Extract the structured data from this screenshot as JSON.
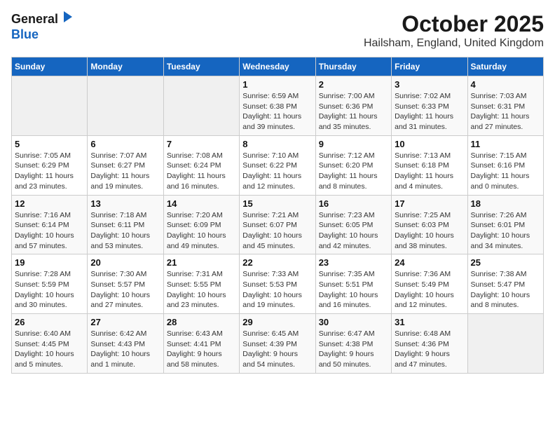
{
  "logo": {
    "general": "General",
    "blue": "Blue"
  },
  "title": "October 2025",
  "location": "Hailsham, England, United Kingdom",
  "weekdays": [
    "Sunday",
    "Monday",
    "Tuesday",
    "Wednesday",
    "Thursday",
    "Friday",
    "Saturday"
  ],
  "weeks": [
    [
      {
        "day": "",
        "info": ""
      },
      {
        "day": "",
        "info": ""
      },
      {
        "day": "",
        "info": ""
      },
      {
        "day": "1",
        "info": "Sunrise: 6:59 AM\nSunset: 6:38 PM\nDaylight: 11 hours\nand 39 minutes."
      },
      {
        "day": "2",
        "info": "Sunrise: 7:00 AM\nSunset: 6:36 PM\nDaylight: 11 hours\nand 35 minutes."
      },
      {
        "day": "3",
        "info": "Sunrise: 7:02 AM\nSunset: 6:33 PM\nDaylight: 11 hours\nand 31 minutes."
      },
      {
        "day": "4",
        "info": "Sunrise: 7:03 AM\nSunset: 6:31 PM\nDaylight: 11 hours\nand 27 minutes."
      }
    ],
    [
      {
        "day": "5",
        "info": "Sunrise: 7:05 AM\nSunset: 6:29 PM\nDaylight: 11 hours\nand 23 minutes."
      },
      {
        "day": "6",
        "info": "Sunrise: 7:07 AM\nSunset: 6:27 PM\nDaylight: 11 hours\nand 19 minutes."
      },
      {
        "day": "7",
        "info": "Sunrise: 7:08 AM\nSunset: 6:24 PM\nDaylight: 11 hours\nand 16 minutes."
      },
      {
        "day": "8",
        "info": "Sunrise: 7:10 AM\nSunset: 6:22 PM\nDaylight: 11 hours\nand 12 minutes."
      },
      {
        "day": "9",
        "info": "Sunrise: 7:12 AM\nSunset: 6:20 PM\nDaylight: 11 hours\nand 8 minutes."
      },
      {
        "day": "10",
        "info": "Sunrise: 7:13 AM\nSunset: 6:18 PM\nDaylight: 11 hours\nand 4 minutes."
      },
      {
        "day": "11",
        "info": "Sunrise: 7:15 AM\nSunset: 6:16 PM\nDaylight: 11 hours\nand 0 minutes."
      }
    ],
    [
      {
        "day": "12",
        "info": "Sunrise: 7:16 AM\nSunset: 6:14 PM\nDaylight: 10 hours\nand 57 minutes."
      },
      {
        "day": "13",
        "info": "Sunrise: 7:18 AM\nSunset: 6:11 PM\nDaylight: 10 hours\nand 53 minutes."
      },
      {
        "day": "14",
        "info": "Sunrise: 7:20 AM\nSunset: 6:09 PM\nDaylight: 10 hours\nand 49 minutes."
      },
      {
        "day": "15",
        "info": "Sunrise: 7:21 AM\nSunset: 6:07 PM\nDaylight: 10 hours\nand 45 minutes."
      },
      {
        "day": "16",
        "info": "Sunrise: 7:23 AM\nSunset: 6:05 PM\nDaylight: 10 hours\nand 42 minutes."
      },
      {
        "day": "17",
        "info": "Sunrise: 7:25 AM\nSunset: 6:03 PM\nDaylight: 10 hours\nand 38 minutes."
      },
      {
        "day": "18",
        "info": "Sunrise: 7:26 AM\nSunset: 6:01 PM\nDaylight: 10 hours\nand 34 minutes."
      }
    ],
    [
      {
        "day": "19",
        "info": "Sunrise: 7:28 AM\nSunset: 5:59 PM\nDaylight: 10 hours\nand 30 minutes."
      },
      {
        "day": "20",
        "info": "Sunrise: 7:30 AM\nSunset: 5:57 PM\nDaylight: 10 hours\nand 27 minutes."
      },
      {
        "day": "21",
        "info": "Sunrise: 7:31 AM\nSunset: 5:55 PM\nDaylight: 10 hours\nand 23 minutes."
      },
      {
        "day": "22",
        "info": "Sunrise: 7:33 AM\nSunset: 5:53 PM\nDaylight: 10 hours\nand 19 minutes."
      },
      {
        "day": "23",
        "info": "Sunrise: 7:35 AM\nSunset: 5:51 PM\nDaylight: 10 hours\nand 16 minutes."
      },
      {
        "day": "24",
        "info": "Sunrise: 7:36 AM\nSunset: 5:49 PM\nDaylight: 10 hours\nand 12 minutes."
      },
      {
        "day": "25",
        "info": "Sunrise: 7:38 AM\nSunset: 5:47 PM\nDaylight: 10 hours\nand 8 minutes."
      }
    ],
    [
      {
        "day": "26",
        "info": "Sunrise: 6:40 AM\nSunset: 4:45 PM\nDaylight: 10 hours\nand 5 minutes."
      },
      {
        "day": "27",
        "info": "Sunrise: 6:42 AM\nSunset: 4:43 PM\nDaylight: 10 hours\nand 1 minute."
      },
      {
        "day": "28",
        "info": "Sunrise: 6:43 AM\nSunset: 4:41 PM\nDaylight: 9 hours\nand 58 minutes."
      },
      {
        "day": "29",
        "info": "Sunrise: 6:45 AM\nSunset: 4:39 PM\nDaylight: 9 hours\nand 54 minutes."
      },
      {
        "day": "30",
        "info": "Sunrise: 6:47 AM\nSunset: 4:38 PM\nDaylight: 9 hours\nand 50 minutes."
      },
      {
        "day": "31",
        "info": "Sunrise: 6:48 AM\nSunset: 4:36 PM\nDaylight: 9 hours\nand 47 minutes."
      },
      {
        "day": "",
        "info": ""
      }
    ]
  ]
}
